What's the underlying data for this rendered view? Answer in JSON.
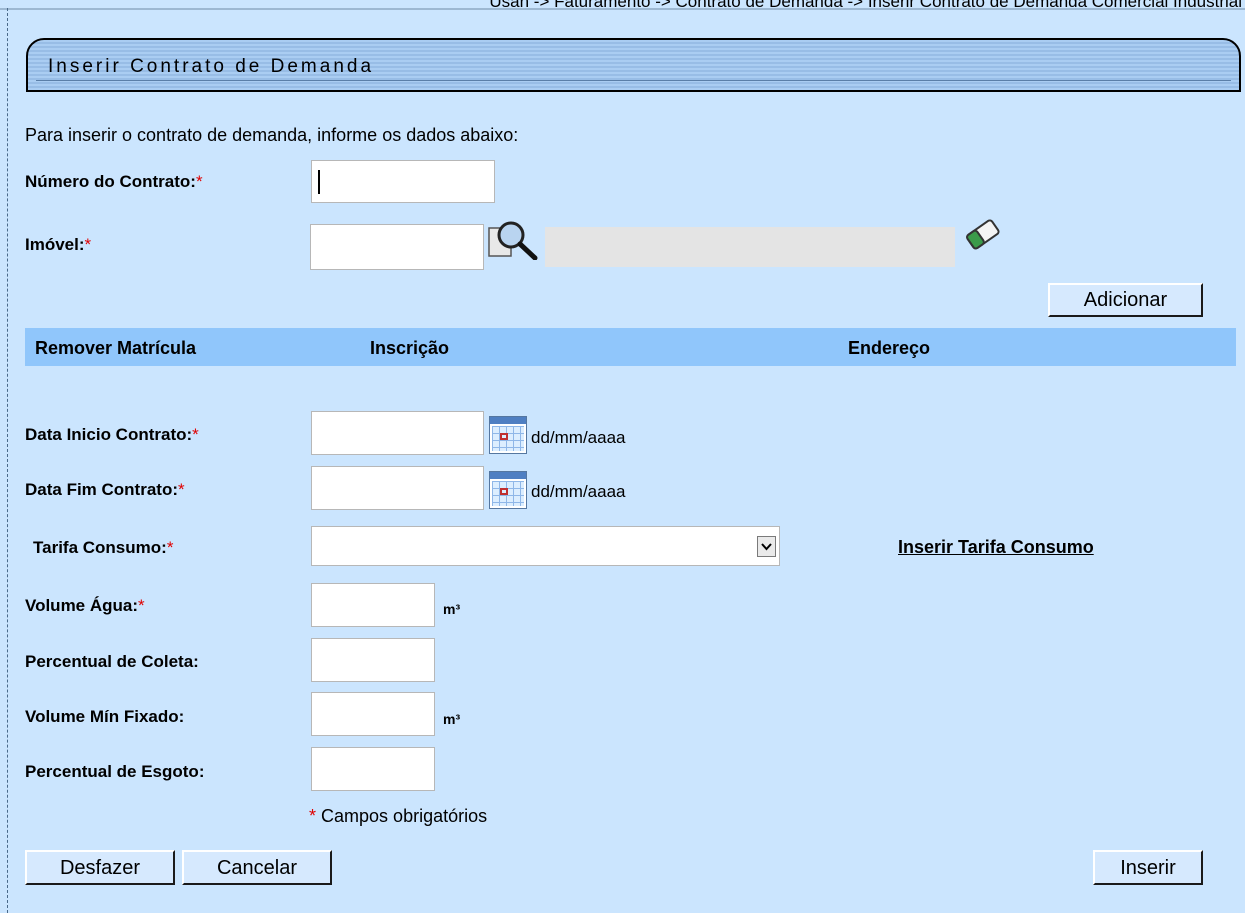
{
  "breadcrumb": "Usan -> Faturamento -> Contrato de Demanda -> Inserir Contrato de Demanda Comercial Industrial",
  "title": "Inserir Contrato de Demanda",
  "intro": "Para inserir o contrato de demanda, informe os dados abaixo:",
  "required_mark": "*",
  "fields": {
    "numero_contrato": {
      "label": "Número do Contrato:",
      "value": ""
    },
    "imovel": {
      "label": "Imóvel:",
      "value": "",
      "description": ""
    },
    "data_inicio": {
      "label": "Data Inicio Contrato:",
      "value": "",
      "format_hint": "dd/mm/aaaa"
    },
    "data_fim": {
      "label": "Data Fim Contrato:",
      "value": "",
      "format_hint": "dd/mm/aaaa"
    },
    "tarifa_consumo": {
      "label": "Tarifa Consumo:",
      "selected": ""
    },
    "volume_agua": {
      "label": "Volume Água:",
      "value": "",
      "unit": "m³"
    },
    "percentual_coleta": {
      "label": "Percentual de Coleta:",
      "value": ""
    },
    "volume_min_fixado": {
      "label": "Volume Mín Fixado:",
      "value": "",
      "unit": "m³"
    },
    "percentual_esgoto": {
      "label": "Percentual de Esgoto:",
      "value": ""
    }
  },
  "table": {
    "columns": [
      "Remover Matrícula",
      "Inscrição",
      "Endereço"
    ],
    "rows": []
  },
  "links": {
    "inserir_tarifa": "Inserir Tarifa Consumo"
  },
  "required_note": "Campos obrigatórios",
  "buttons": {
    "adicionar": "Adicionar",
    "desfazer": "Desfazer",
    "cancelar": "Cancelar",
    "inserir": "Inserir"
  },
  "icons": {
    "search": "magnifier-icon",
    "clear": "eraser-icon",
    "calendar": "calendar-icon",
    "dropdown": "chevron-down-icon"
  },
  "colors": {
    "background": "#cbe5fe",
    "table_header": "#90c6fb",
    "required": "#e00000"
  }
}
